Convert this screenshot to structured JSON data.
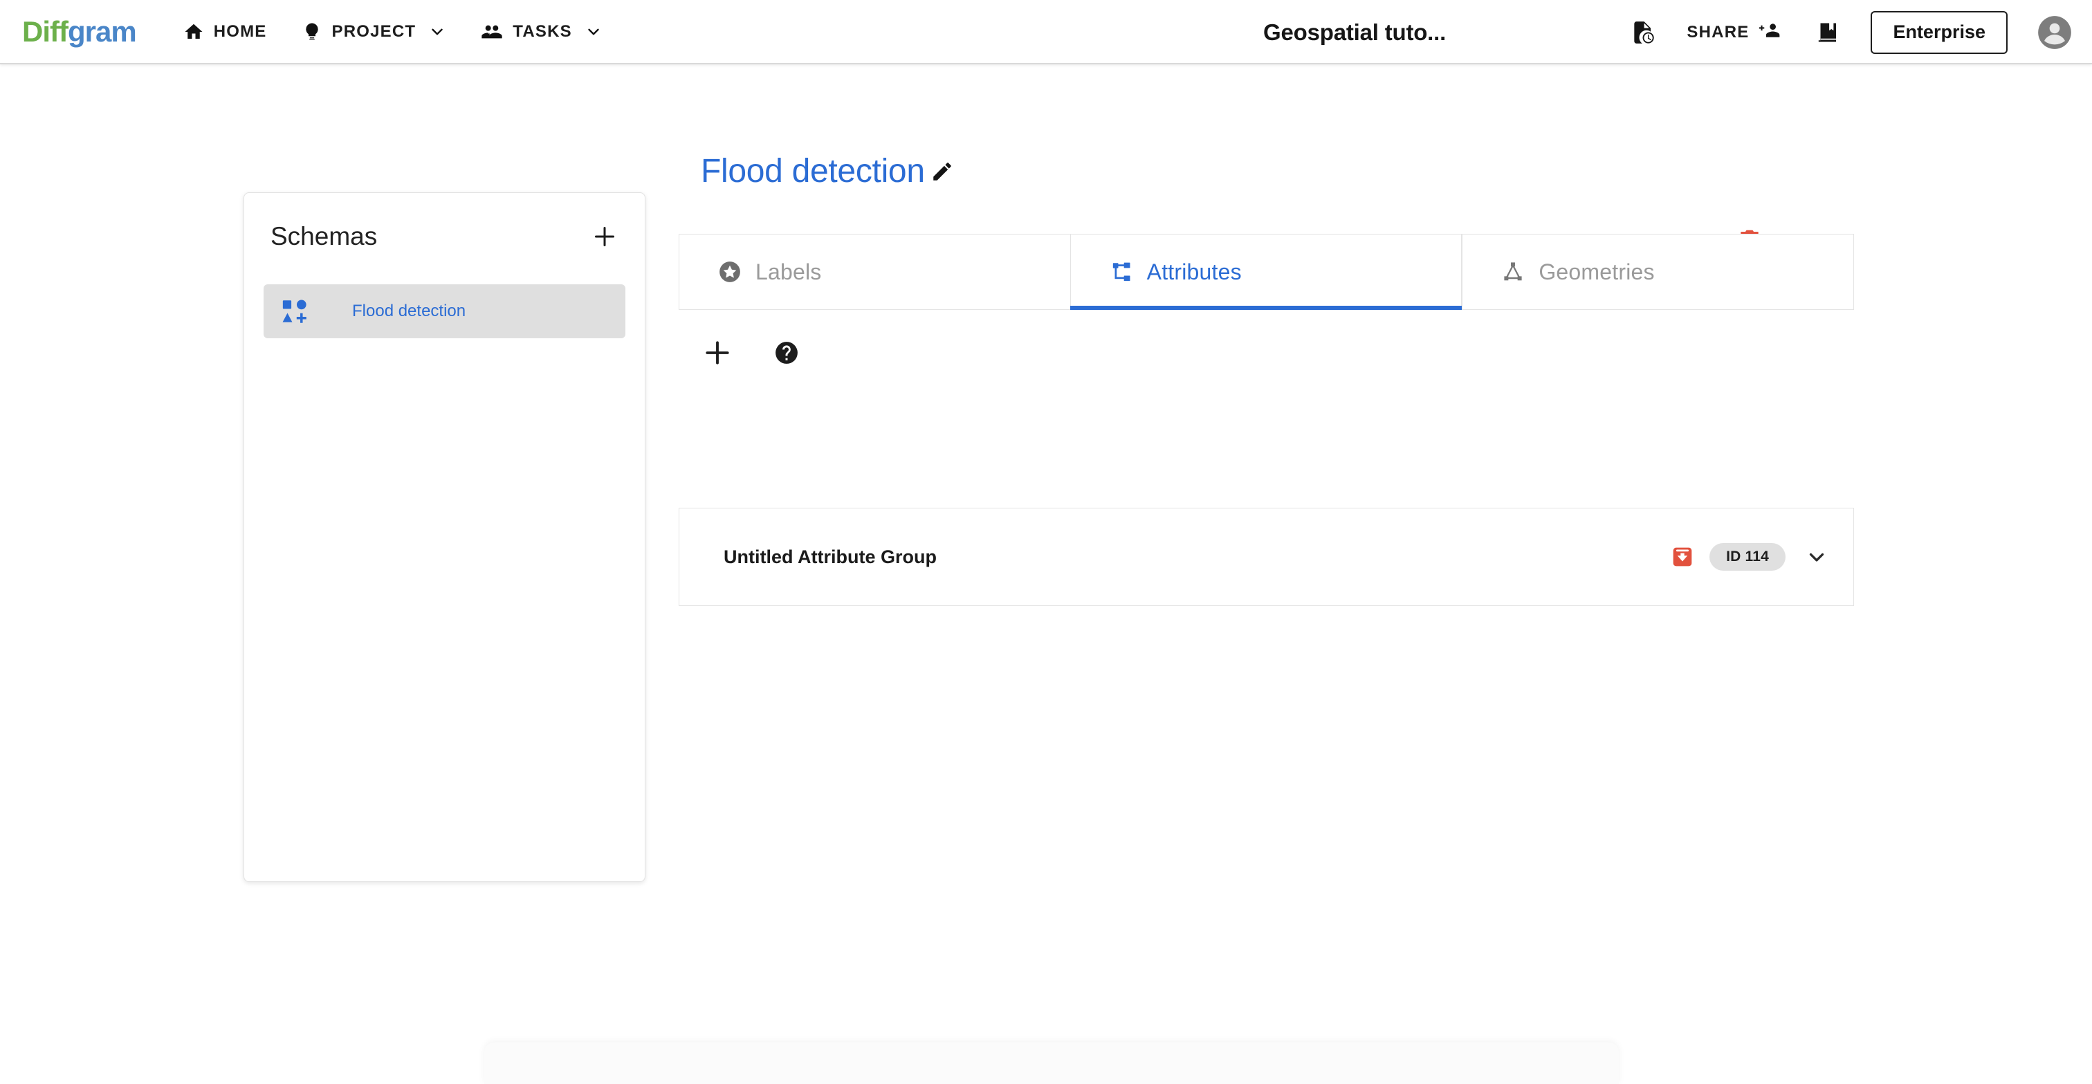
{
  "app_bar": {
    "logo": {
      "part1": "Diff",
      "part2": "gram",
      "color1": "#6cb04b",
      "color2": "#4a86c8"
    },
    "nav_items": [
      {
        "label": "HOME",
        "icon": "home-icon",
        "has_caret": false
      },
      {
        "label": "PROJECT",
        "icon": "lightbulb-icon",
        "has_caret": true
      },
      {
        "label": "TASKS",
        "icon": "people-icon",
        "has_caret": true
      }
    ],
    "document_title": "Geospatial tuto...",
    "history_icon": "file-clock-icon",
    "share_label": "SHARE",
    "share_icon": "person-add-icon",
    "guide_icon": "bookmark-book-icon",
    "enterprise_label": "Enterprise",
    "avatar_icon": "account-circle-icon"
  },
  "schemas_panel": {
    "title": "Schemas",
    "add_icon": "plus-icon",
    "items": [
      {
        "label": "Flood detection",
        "icon": "schema-shapes-icon",
        "selected": true
      }
    ]
  },
  "schema_detail": {
    "title": "Flood detection",
    "edit_icon": "pencil-icon",
    "delete_icon": "trash-icon",
    "delete_color": "#e2513d",
    "accent_color": "#2b6cd4",
    "tabs": [
      {
        "label": "Labels",
        "icon": "star-circle-icon",
        "active": false
      },
      {
        "label": "Attributes",
        "icon": "account-tree-icon",
        "active": true
      },
      {
        "label": "Geometries",
        "icon": "triangle-nodes-icon",
        "active": false
      }
    ],
    "toolbar": [
      {
        "name": "add-attribute-group",
        "icon": "plus-icon"
      },
      {
        "name": "help",
        "icon": "help-circle-icon"
      }
    ],
    "attribute_groups": [
      {
        "name": "Untitled Attribute Group",
        "archive_icon": "archive-down-icon",
        "archive_color": "#e2513d",
        "id_chip": "ID 114",
        "expand_icon": "chevron-down-icon"
      }
    ]
  }
}
